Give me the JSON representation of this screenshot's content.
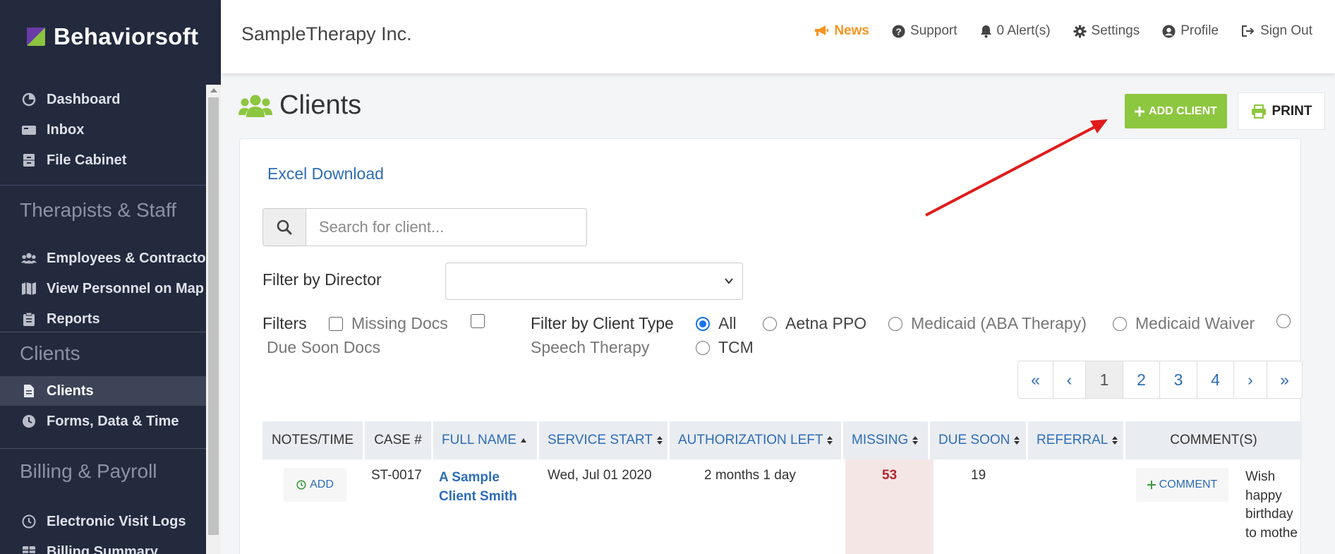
{
  "brand": {
    "name": "Behaviorsoft"
  },
  "sidebar": {
    "items": [
      {
        "label": "Dashboard",
        "icon": "dashboard-icon"
      },
      {
        "label": "Inbox",
        "icon": "inbox-icon"
      },
      {
        "label": "File Cabinet",
        "icon": "file-cabinet-icon"
      },
      {
        "label": "Employees & Contractors",
        "icon": "users-icon"
      },
      {
        "label": "View Personnel on Map",
        "icon": "map-icon"
      },
      {
        "label": "Reports",
        "icon": "clipboard-icon"
      },
      {
        "label": "Clients",
        "icon": "file-icon",
        "active": true
      },
      {
        "label": "Forms, Data & Time",
        "icon": "clock-icon"
      },
      {
        "label": "Electronic Visit Logs",
        "icon": "clock-outline-icon"
      },
      {
        "label": "Billing Summary",
        "icon": "table-icon"
      }
    ],
    "sections": [
      "Therapists & Staff",
      "Clients",
      "Billing & Payroll"
    ]
  },
  "header": {
    "company": "SampleTherapy Inc.",
    "links": {
      "news": "News",
      "support": "Support",
      "alerts": "0 Alert(s)",
      "settings": "Settings",
      "profile": "Profile",
      "signout": "Sign Out"
    },
    "news_color": "#f7941d"
  },
  "page": {
    "title": "Clients",
    "add_client": "ADD CLIENT",
    "print": "PRINT",
    "accent": "#8dc63f"
  },
  "panel": {
    "excel_download": "Excel Download",
    "search_placeholder": "Search for client...",
    "filter_director_label": "Filter by Director",
    "filters_label": "Filters",
    "filter_missing": "Missing Docs",
    "filter_due_soon": "Due Soon Docs",
    "client_type_label": "Filter by Client Type",
    "client_types": [
      "All",
      "Aetna PPO",
      "Medicaid (ABA Therapy)",
      "Medicaid Waiver",
      "Speech Therapy",
      "TCM"
    ],
    "pager": [
      "«",
      "‹",
      "1",
      "2",
      "3",
      "4",
      "›",
      "»"
    ]
  },
  "table": {
    "headers": [
      "NOTES/TIME",
      "CASE #",
      "FULL NAME",
      "SERVICE START",
      "AUTHORIZATION LEFT",
      "MISSING",
      "DUE SOON",
      "REFERRAL",
      "COMMENT(S)"
    ],
    "row": {
      "add_note": "ADD",
      "case": "ST-0017",
      "name_line1": "A Sample",
      "name_line2": "Client Smith",
      "service_start": "Wed, Jul 01 2020",
      "auth_left": "2 months 1 day",
      "missing": "53",
      "due_soon": "19",
      "referral": "",
      "comment_btn": "COMMENT",
      "comment_lines": [
        "Wish",
        "happy",
        "birthday",
        "to mothe"
      ]
    }
  }
}
